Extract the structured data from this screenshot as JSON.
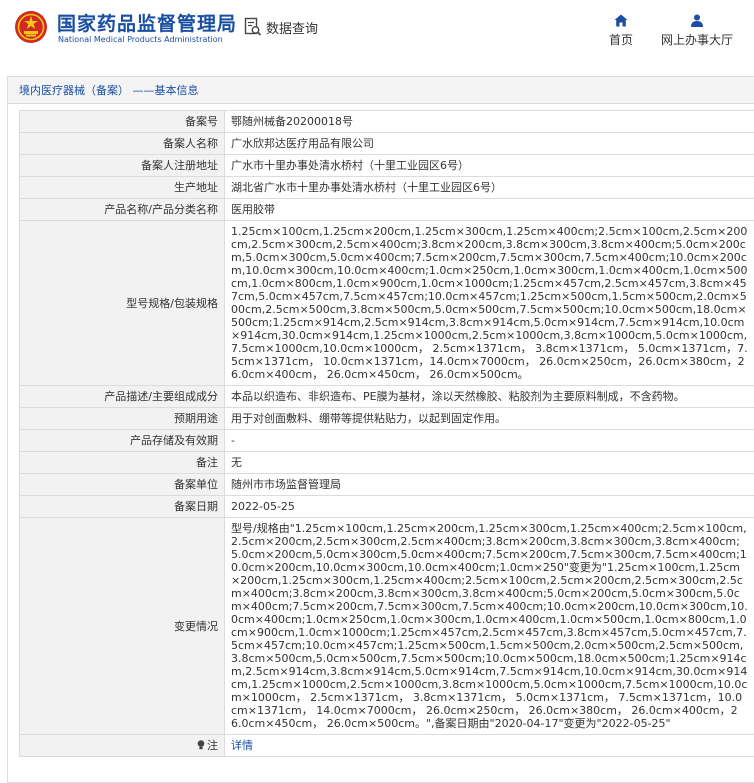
{
  "header": {
    "logo_cn": "国家药品监督管理局",
    "logo_en": "National Medical Products Administration",
    "query_label": "数据查询",
    "nav_home": "首页",
    "nav_hall": "网上办事大厅",
    "brand_color": "#1a4ea3"
  },
  "panel": {
    "title": "境内医疗器械（备案） ——基本信息"
  },
  "record": {
    "k_no": "备案号",
    "v_no": "鄂随州械备20200018号",
    "k_person": "备案人名称",
    "v_person": "广水欣邦达医疗用品有限公司",
    "k_reg_addr": "备案人注册地址",
    "v_reg_addr": "广水市十里办事处清水桥村（十里工业园区6号）",
    "k_prod_addr": "生产地址",
    "v_prod_addr": "湖北省广水市十里办事处清水桥村（十里工业园区6号）",
    "k_name": "产品名称/产品分类名称",
    "v_name": "医用胶带",
    "k_model": "型号规格/包装规格",
    "v_model": "1.25cm×100cm,1.25cm×200cm,1.25cm×300cm,1.25cm×400cm;2.5cm×100cm,2.5cm×200cm,2.5cm×300cm,2.5cm×400cm;3.8cm×200cm,3.8cm×300cm,3.8cm×400cm;5.0cm×200cm,5.0cm×300cm,5.0cm×400cm;7.5cm×200cm,7.5cm×300cm,7.5cm×400cm;10.0cm×200cm,10.0cm×300cm,10.0cm×400cm;1.0cm×250cm,1.0cm×300cm,1.0cm×400cm,1.0cm×500cm,1.0cm×800cm,1.0cm×900cm,1.0cm×1000cm;1.25cm×457cm,2.5cm×457cm,3.8cm×457cm,5.0cm×457cm,7.5cm×457cm;10.0cm×457cm;1.25cm×500cm,1.5cm×500cm,2.0cm×500cm,2.5cm×500cm,3.8cm×500cm,5.0cm×500cm,7.5cm×500cm;10.0cm×500cm,18.0cm×500cm;1.25cm×914cm,2.5cm×914cm,3.8cm×914cm,5.0cm×914cm,7.5cm×914cm,10.0cm×914cm,30.0cm×914cm,1.25cm×1000cm,2.5cm×1000cm,3.8cm×1000cm,5.0cm×1000cm,7.5cm×1000cm,10.0cm×1000cm， 2.5cm×1371cm， 3.8cm×1371cm， 5.0cm×1371cm，7.5cm×1371cm， 10.0cm×1371cm，14.0cm×7000cm， 26.0cm×250cm，26.0cm×380cm，26.0cm×400cm， 26.0cm×450cm， 26.0cm×500cm。",
    "k_desc": "产品描述/主要组成成分",
    "v_desc": "本品以织造布、非织造布、PE膜为基材，涂以天然橡胶、粘胶剂为主要原料制成，不含药物。",
    "k_use": "预期用途",
    "v_use": "用于对创面敷料、绷带等提供粘贴力，以起到固定作用。",
    "k_storage": "产品存储及有效期",
    "v_storage": "-",
    "k_remark": "备注",
    "v_remark": "无",
    "k_unit": "备案单位",
    "v_unit": "随州市市场监督管理局",
    "k_date": "备案日期",
    "v_date": "2022-05-25",
    "k_change": "变更情况",
    "v_change": "型号/规格由\"1.25cm×100cm,1.25cm×200cm,1.25cm×300cm,1.25cm×400cm;2.5cm×100cm,2.5cm×200cm,2.5cm×300cm,2.5cm×400cm;3.8cm×200cm,3.8cm×300cm,3.8cm×400cm;5.0cm×200cm,5.0cm×300cm,5.0cm×400cm;7.5cm×200cm,7.5cm×300cm,7.5cm×400cm;10.0cm×200cm,10.0cm×300cm,10.0cm×400cm;1.0cm×250\"变更为\"1.25cm×100cm,1.25cm×200cm,1.25cm×300cm,1.25cm×400cm;2.5cm×100cm,2.5cm×200cm,2.5cm×300cm,2.5cm×400cm;3.8cm×200cm,3.8cm×300cm,3.8cm×400cm;5.0cm×200cm,5.0cm×300cm,5.0cm×400cm;7.5cm×200cm,7.5cm×300cm,7.5cm×400cm;10.0cm×200cm,10.0cm×300cm,10.0cm×400cm;1.0cm×250cm,1.0cm×300cm,1.0cm×400cm,1.0cm×500cm,1.0cm×800cm,1.0cm×900cm,1.0cm×1000cm;1.25cm×457cm,2.5cm×457cm,3.8cm×457cm,5.0cm×457cm,7.5cm×457cm;10.0cm×457cm;1.25cm×500cm,1.5cm×500cm,2.0cm×500cm,2.5cm×500cm,3.8cm×500cm,5.0cm×500cm,7.5cm×500cm;10.0cm×500cm,18.0cm×500cm;1.25cm×914cm,2.5cm×914cm,3.8cm×914cm,5.0cm×914cm,7.5cm×914cm,10.0cm×914cm,30.0cm×914cm,1.25cm×1000cm,2.5cm×1000cm,3.8cm×1000cm,5.0cm×1000cm,7.5cm×1000cm,10.0cm×1000cm， 2.5cm×1371cm， 3.8cm×1371cm， 5.0cm×1371cm， 7.5cm×1371cm，10.0cm×1371cm， 14.0cm×7000cm， 26.0cm×250cm， 26.0cm×380cm， 26.0cm×400cm，26.0cm×450cm， 26.0cm×500cm。\",备案日期由\"2020-04-17\"变更为\"2022-05-25\"",
    "k_note": "注",
    "v_note": "详情"
  }
}
